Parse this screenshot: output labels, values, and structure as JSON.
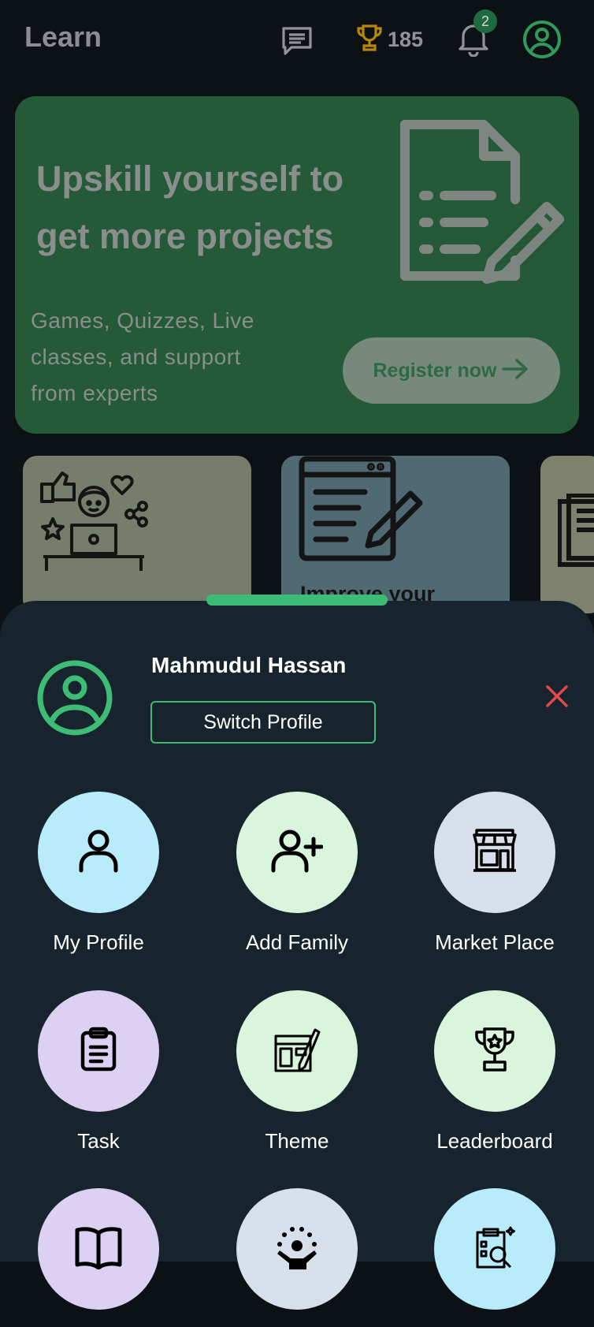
{
  "header": {
    "title": "Learn",
    "score": "185",
    "notification_count": "2"
  },
  "hero": {
    "title": "Upskill yourself to get more projects",
    "subtitle": "Games, Quizzes, Live classes, and support from experts",
    "button_label": "Register now"
  },
  "cards": [
    {
      "label": ""
    },
    {
      "label": "Improve your"
    },
    {
      "label": ""
    }
  ],
  "profile_sheet": {
    "user_name": "Mahmudul Hassan",
    "switch_label": "Switch Profile",
    "menu": [
      {
        "label": "My Profile",
        "icon": "user-icon",
        "color": "#b9ecfb"
      },
      {
        "label": "Add Family",
        "icon": "user-plus-icon",
        "color": "#d9f6dd"
      },
      {
        "label": "Market Place",
        "icon": "store-icon",
        "color": "#d6dfea"
      },
      {
        "label": "Task",
        "icon": "clipboard-icon",
        "color": "#dcd0f3"
      },
      {
        "label": "Theme",
        "icon": "palette-icon",
        "color": "#d9f6dd"
      },
      {
        "label": "Leaderboard",
        "icon": "trophy-icon",
        "color": "#d9f6dd"
      },
      {
        "label": "",
        "icon": "book-icon",
        "color": "#dcd0f3"
      },
      {
        "label": "",
        "icon": "community-icon",
        "color": "#d6dfea"
      },
      {
        "label": "",
        "icon": "report-icon",
        "color": "#b9ecfb"
      }
    ]
  },
  "colors": {
    "accent": "#3cbc74",
    "background": "#0c1116",
    "sheet": "#17242d",
    "close": "#e54848",
    "trophy": "#b8860b"
  }
}
